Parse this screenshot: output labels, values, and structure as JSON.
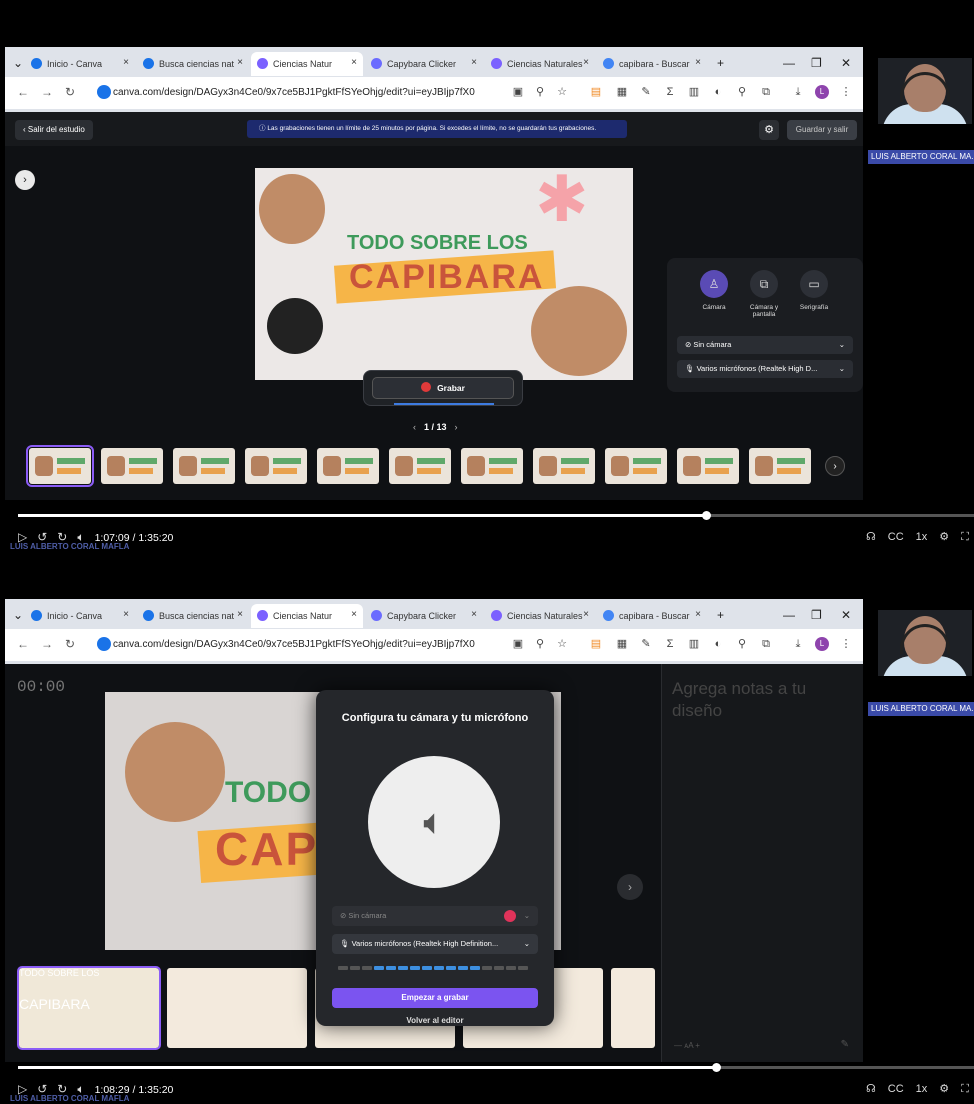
{
  "browser": {
    "tabs": [
      {
        "label": "Inicio - Canva",
        "color": "#1a73e8"
      },
      {
        "label": "Busca ciencias nat",
        "color": "#1a73e8"
      },
      {
        "label": "Ciencias Natur",
        "color": "#7b61ff"
      },
      {
        "label": "Capybara Clicker",
        "color": "#6b6bff"
      },
      {
        "label": "Ciencias Naturales",
        "color": "#7b61ff"
      },
      {
        "label": "capibara - Buscar",
        "color": "#4285f4"
      }
    ],
    "new_tab": "+",
    "url": "canva.com/design/DAGyx3n4Ce0/9x7ce5BJ1PgktFfSYeOhjg/edit?ui=eyJBIjp7fX0"
  },
  "webcam": {
    "name_badge": "LUIS ALBERTO CORAL MA..."
  },
  "frame1": {
    "exit_label": "Salir del estudio",
    "notice": "Las grabaciones tienen un límite de 25 minutos por página. Si excedes el límite, no se guardarán tus grabaciones.",
    "save_label": "Guardar y salir",
    "slide_line1": "TODO SOBRE LOS",
    "slide_line2": "CAPIBARA",
    "record_label": "Grabar",
    "page": "1 / 13",
    "options": [
      {
        "label": "Cámara",
        "icon": "person-icon",
        "selected": true
      },
      {
        "label": "Cámara y pantalla",
        "icon": "camera-screen-icon",
        "selected": false
      },
      {
        "label": "Serigrafía",
        "icon": "screen-icon",
        "selected": false
      }
    ],
    "camera_select": "Sin cámara",
    "mic_select": "Varios micrófonos (Realtek High D...",
    "player_time": "1:07:09 / 1:35:20",
    "progress": 0.72
  },
  "frame2": {
    "timer": "00:00",
    "notes_placeholder": "Agrega notas a tu diseño",
    "modal_title": "Configura tu cámara y tu micrófono",
    "camera_select": "Sin cámara",
    "mic_select": "Varios micrófonos (Realtek High Definition...",
    "start_label": "Empezar a grabar",
    "back_label": "Volver al editor",
    "slide_line1": "TODO S",
    "slide_line2": "CAP",
    "thumb_line1": "TODO SOBRE LOS",
    "thumb_line2": "CAPIBARA",
    "mic_level": 0.55,
    "player_time": "1:08:29 / 1:35:20",
    "progress": 0.73
  },
  "player": {
    "speed": "1x",
    "cc": "CC",
    "watermark": "LUIS ALBERTO CORAL MAFLA"
  }
}
